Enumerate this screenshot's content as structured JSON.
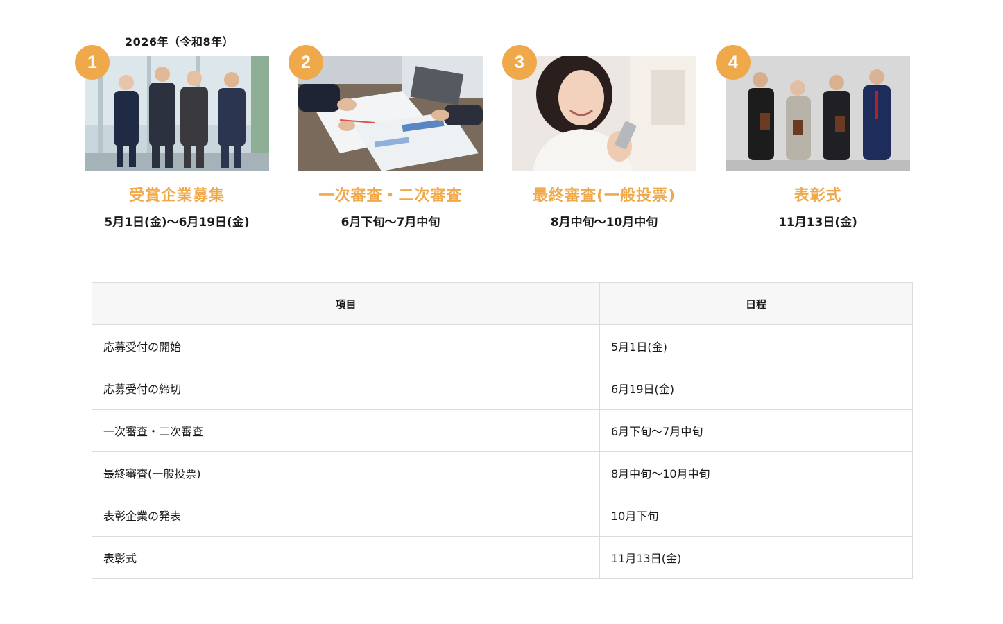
{
  "year_label": "2026年（令和8年）",
  "accent_color": "#f0a94a",
  "steps": [
    {
      "number": "1",
      "title": "受賞企業募集",
      "date": "5月1日(金)〜6月19日(金)",
      "photo": "business-team-photo"
    },
    {
      "number": "2",
      "title": "一次審査・二次審査",
      "date": "6月下旬〜7月中旬",
      "photo": "meeting-documents-photo"
    },
    {
      "number": "3",
      "title": "最終審査(一般投票)",
      "date": "8月中旬〜10月中旬",
      "photo": "woman-smartphone-photo"
    },
    {
      "number": "4",
      "title": "表彰式",
      "date": "11月13日(金)",
      "photo": "award-ceremony-photo"
    }
  ],
  "table": {
    "headers": [
      "項目",
      "日程"
    ],
    "rows": [
      [
        "応募受付の開始",
        "5月1日(金)"
      ],
      [
        "応募受付の締切",
        "6月19日(金)"
      ],
      [
        "一次審査・二次審査",
        "6月下旬〜7月中旬"
      ],
      [
        "最終審査(一般投票)",
        "8月中旬〜10月中旬"
      ],
      [
        "表彰企業の発表",
        "10月下旬"
      ],
      [
        "表彰式",
        "11月13日(金)"
      ]
    ]
  }
}
